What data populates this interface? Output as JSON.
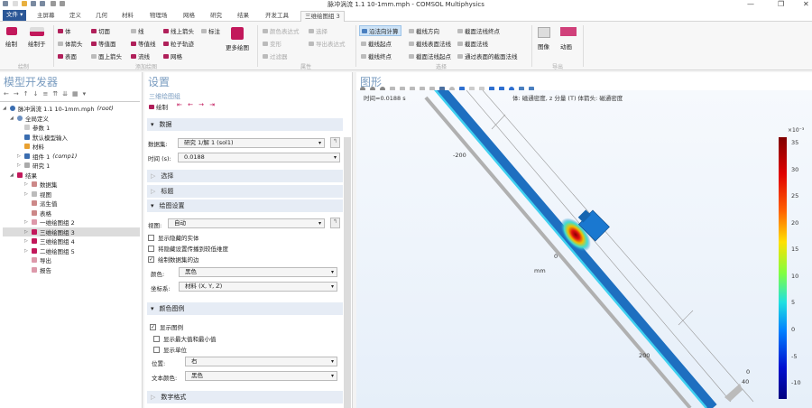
{
  "window": {
    "title": "脉冲涡流 1.1 10-1mm.mph - COMSOL Multiphysics",
    "controls": [
      "—",
      "❐",
      "✕"
    ]
  },
  "tabs": [
    "文件 ▾",
    "主屏幕",
    "定义",
    "几何",
    "材料",
    "物理场",
    "网格",
    "研究",
    "结果",
    "开发工具",
    "三维绘图组 3"
  ],
  "ribbon": {
    "plot": {
      "draw": "绘制",
      "draw_in": "绘制于",
      "group": "绘制"
    },
    "add_plot": {
      "items": [
        "体",
        "切面",
        "线",
        "线上箭头",
        "标注",
        "体箭头",
        "等值面",
        "等值线",
        "粒子轨迹",
        "表面",
        "面上箭头",
        "流线",
        "网格"
      ],
      "more": "更多绘图",
      "group": "添加绘图"
    },
    "attributes": {
      "items": [
        "颜色表达式",
        "选择",
        "变形",
        "导出表达式",
        "过滤器"
      ],
      "group": "属性"
    },
    "selection": {
      "items": [
        "沿法向计算",
        "截线方向",
        "截面法线终点",
        "截线起点",
        "截线表面法线",
        "截面法线",
        "截线终点",
        "截面法线起点",
        "通过表面的截面法线"
      ],
      "group": "选择"
    },
    "export": {
      "image": "图像",
      "animation": "动画",
      "group": "导出"
    }
  },
  "model_builder": {
    "title": "模型开发器",
    "root": "脉冲涡流 1.1 10-1mm.mph",
    "root_tag": "(root)",
    "items": [
      {
        "label": "全局定义",
        "tag": ""
      },
      {
        "label": "参数 1",
        "tag": ""
      },
      {
        "label": "默认模型输入",
        "tag": ""
      },
      {
        "label": "材料",
        "tag": ""
      },
      {
        "label": "组件 1",
        "tag": "(comp1)"
      },
      {
        "label": "研究 1",
        "tag": ""
      },
      {
        "label": "结果",
        "tag": ""
      },
      {
        "label": "数据集",
        "tag": ""
      },
      {
        "label": "视图",
        "tag": ""
      },
      {
        "label": "派生值",
        "tag": ""
      },
      {
        "label": "表格",
        "tag": ""
      },
      {
        "label": "一维绘图组 2",
        "tag": ""
      },
      {
        "label": "三维绘图组 3",
        "tag": ""
      },
      {
        "label": "三维绘图组 4",
        "tag": ""
      },
      {
        "label": "二维绘图组 5",
        "tag": ""
      },
      {
        "label": "导出",
        "tag": ""
      },
      {
        "label": "报告",
        "tag": ""
      }
    ]
  },
  "settings": {
    "title": "设置",
    "subtitle": "三维绘图组",
    "draw": "绘制",
    "sections": {
      "data": "数据",
      "selection": "选择",
      "heading": "标题",
      "plot_settings": "绘图设置",
      "color_legend": "颜色图例",
      "number_format": "数字格式"
    },
    "dataset_label": "数据集:",
    "dataset_value": "研究 1/解 1 (sol1)",
    "time_label": "时间 (s):",
    "time_value": "0.0188",
    "view_label": "视图:",
    "view_value": "自动",
    "show_hidden": "显示隐藏的实体",
    "propagate_hidden": "将隐藏设置传播到较低维度",
    "plot_edges": "绘制数据集的边",
    "color_label": "颜色:",
    "color_value": "黑色",
    "frame_label": "坐标系:",
    "frame_value": "材料 (X, Y, Z)",
    "show_legend": "显示图例",
    "show_maxmin": "显示最大值和最小值",
    "show_units": "显示单位",
    "position_label": "位置:",
    "position_value": "右",
    "text_color_label": "文本颜色:",
    "text_color_value": "黑色"
  },
  "graphics": {
    "title": "图形",
    "time_text": "时间=0.0188 s",
    "plot_title": "体: 磁通密度, z 分量 (T)  体箭头: 磁通密度",
    "axis_labels": [
      "-200",
      "0",
      "mm",
      "200",
      "0",
      "40"
    ],
    "colorbar": {
      "exponent": "×10⁻³",
      "ticks": [
        "35",
        "30",
        "25",
        "20",
        "15",
        "10",
        "5",
        "0",
        "-5",
        "-10"
      ],
      "min": -13,
      "max": 36
    }
  }
}
